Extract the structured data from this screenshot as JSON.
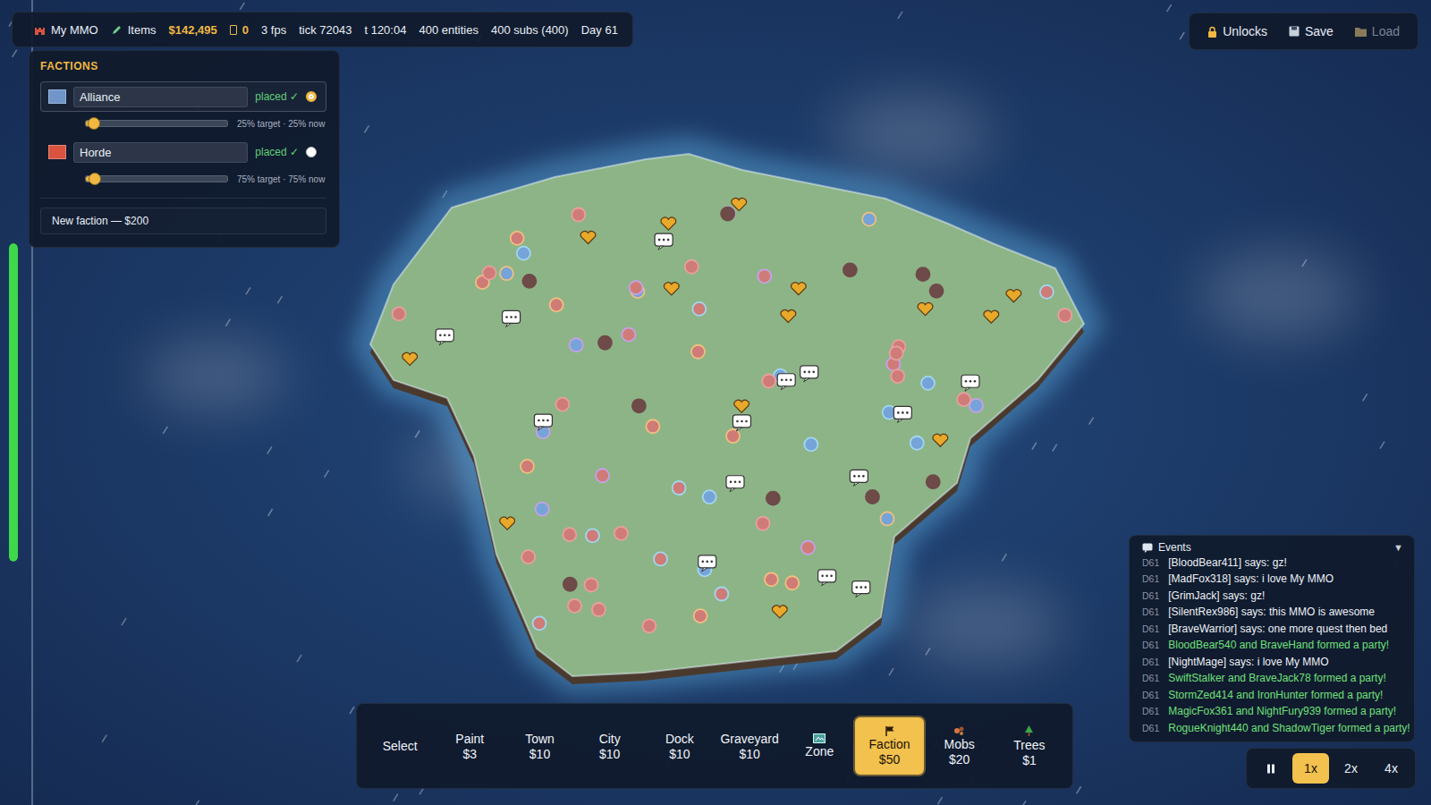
{
  "topbar": {
    "title": "My MMO",
    "items_button": "Items",
    "money": "$142,495",
    "gems": "0",
    "fps": "3 fps",
    "tick": "tick 72043",
    "time": "t 120:04",
    "entities": "400 entities",
    "subs": "400 subs (400)",
    "day": "Day 61"
  },
  "top_actions": [
    {
      "label": "Unlocks",
      "disabled": false
    },
    {
      "label": "Save",
      "disabled": false
    },
    {
      "label": "Load",
      "disabled": true
    }
  ],
  "factions": {
    "title": "FACTIONS",
    "items": [
      {
        "name": "Alliance",
        "color": "#6f95c9",
        "status": "placed ✓",
        "selected": true,
        "level": 0.03,
        "reading": "25% target · 25% now"
      },
      {
        "name": "Horde",
        "color": "#d9533f",
        "status": "placed ✓",
        "selected": false,
        "level": 0.04,
        "reading": "75% target · 75% now"
      }
    ],
    "new_button": "New faction — $200"
  },
  "side_meter": {
    "level": 1
  },
  "tools": [
    {
      "label": "Select",
      "price": "",
      "selected": false,
      "kind": "plain"
    },
    {
      "label": "Paint",
      "price": "$3",
      "selected": false,
      "kind": "plain"
    },
    {
      "label": "Town",
      "price": "$10",
      "selected": false,
      "kind": "plain"
    },
    {
      "label": "City",
      "price": "$10",
      "selected": false,
      "kind": "plain"
    },
    {
      "label": "Dock",
      "price": "$10",
      "selected": false,
      "kind": "plain"
    },
    {
      "label": "Graveyard",
      "price": "$10",
      "selected": false,
      "kind": "plain"
    },
    {
      "label": "Zone",
      "price": "",
      "selected": false,
      "kind": "icon"
    },
    {
      "label": "Faction",
      "price": "$50",
      "selected": true,
      "kind": "icon"
    },
    {
      "label": "Mobs",
      "price": "$20",
      "selected": false,
      "kind": "icon"
    },
    {
      "label": "Trees",
      "price": "$1",
      "selected": false,
      "kind": "icon"
    }
  ],
  "events": {
    "title": "Events",
    "toggle": "▼",
    "lines": [
      {
        "day": "D61",
        "text": "[BloodBear411] says: gz!",
        "kind": "chat"
      },
      {
        "day": "D61",
        "text": "[MadFox318] says: i love My MMO",
        "kind": "chat"
      },
      {
        "day": "D61",
        "text": "[GrimJack] says: gz!",
        "kind": "chat"
      },
      {
        "day": "D61",
        "text": "[SilentRex986] says: this MMO is awesome",
        "kind": "chat"
      },
      {
        "day": "D61",
        "text": "[BraveWarrior] says: one more quest then bed",
        "kind": "chat"
      },
      {
        "day": "D61",
        "text": "BloodBear540 and BraveHand formed a party!",
        "kind": "party"
      },
      {
        "day": "D61",
        "text": "[NightMage] says: i love My MMO",
        "kind": "chat"
      },
      {
        "day": "D61",
        "text": "SwiftStalker and BraveJack78 formed a party!",
        "kind": "party"
      },
      {
        "day": "D61",
        "text": "StormZed414 and IronHunter formed a party!",
        "kind": "party"
      },
      {
        "day": "D61",
        "text": "MagicFox361 and NightFury939 formed a party!",
        "kind": "party"
      },
      {
        "day": "D61",
        "text": "RogueKnight440 and ShadowTiger formed a party!",
        "kind": "party"
      }
    ]
  },
  "speed": {
    "paused": false,
    "options": [
      {
        "label": "1x",
        "selected": true
      },
      {
        "label": "2x",
        "selected": false
      },
      {
        "label": "4x",
        "selected": false
      }
    ]
  },
  "map": {
    "entities": [
      {
        "kind": "player",
        "color": "#cf7b78",
        "ring": "#e8a0a0"
      },
      {
        "kind": "player",
        "color": "#76a3d8",
        "ring": "#a0d8f0"
      },
      {
        "kind": "player",
        "color": "#cf7b78",
        "ring": "#f0c080"
      },
      {
        "kind": "player",
        "color": "#6e4a48",
        "ring": "#6e4a48"
      },
      {
        "kind": "player",
        "color": "#cf7b78",
        "ring": "#c8a0e8"
      },
      {
        "kind": "player",
        "color": "#cf7b78",
        "ring": "#e8a0a0"
      },
      {
        "kind": "player",
        "color": "#76a3d8",
        "ring": "#c8a0e8"
      },
      {
        "kind": "player",
        "color": "#cf7b78",
        "ring": "#a0d8f0"
      },
      {
        "kind": "player",
        "color": "#6e4a48",
        "ring": "#6e4a48"
      },
      {
        "kind": "player",
        "color": "#cf7b78",
        "ring": "#f0c080"
      },
      {
        "kind": "player",
        "color": "#cf7b78",
        "ring": "#e8a0a0"
      },
      {
        "kind": "player",
        "color": "#76a3d8",
        "ring": "#a0d8f0"
      },
      {
        "kind": "player",
        "color": "#cf7b78",
        "ring": "#c8a0e8"
      },
      {
        "kind": "player",
        "color": "#cf7b78",
        "ring": "#e8a0a0"
      },
      {
        "kind": "player",
        "color": "#6e4a48",
        "ring": "#6e4a48"
      },
      {
        "kind": "player",
        "color": "#cf7b78",
        "ring": "#f0c080"
      },
      {
        "kind": "player",
        "color": "#76a3d8",
        "ring": "#f0c080"
      },
      {
        "kind": "player",
        "color": "#cf7b78",
        "ring": "#e8a0a0"
      },
      {
        "kind": "player",
        "color": "#cf7b78",
        "ring": "#a0d8f0"
      },
      {
        "kind": "player",
        "color": "#76a3d8",
        "ring": "#a0d8f0"
      },
      {
        "kind": "player",
        "color": "#cf7b78",
        "ring": "#e8a0a0"
      },
      {
        "kind": "player",
        "color": "#6e4a48",
        "ring": "#6e4a48"
      },
      {
        "kind": "player",
        "color": "#cf7b78",
        "ring": "#c8a0e8"
      },
      {
        "kind": "player",
        "color": "#cf7b78",
        "ring": "#f0c080"
      },
      {
        "kind": "player",
        "color": "#76a3d8",
        "ring": "#c8a0e8"
      },
      {
        "kind": "player",
        "color": "#cf7b78",
        "ring": "#e8a0a0"
      },
      {
        "kind": "player",
        "color": "#cf7b78",
        "ring": "#e8a0a0"
      },
      {
        "kind": "player",
        "color": "#6e4a48",
        "ring": "#6e4a48"
      },
      {
        "kind": "player",
        "color": "#cf7b78",
        "ring": "#a0d8f0"
      },
      {
        "kind": "player",
        "color": "#76a3d8",
        "ring": "#a0d8f0"
      },
      {
        "kind": "player",
        "color": "#cf7b78",
        "ring": "#f0c080"
      },
      {
        "kind": "player",
        "color": "#cf7b78",
        "ring": "#e8a0a0"
      },
      {
        "kind": "player",
        "color": "#76a3d8",
        "ring": "#f0c080"
      },
      {
        "kind": "player",
        "color": "#cf7b78",
        "ring": "#c8a0e8"
      },
      {
        "kind": "player",
        "color": "#6e4a48",
        "ring": "#6e4a48"
      },
      {
        "kind": "player",
        "color": "#cf7b78",
        "ring": "#e8a0a0"
      },
      {
        "kind": "player",
        "color": "#cf7b78",
        "ring": "#a0d8f0"
      },
      {
        "kind": "player",
        "color": "#76a3d8",
        "ring": "#a0d8f0"
      },
      {
        "kind": "player",
        "color": "#cf7b78",
        "ring": "#e8a0a0"
      },
      {
        "kind": "player",
        "color": "#cf7b78",
        "ring": "#f0c080"
      },
      {
        "kind": "player",
        "color": "#6e4a48",
        "ring": "#6e4a48"
      },
      {
        "kind": "player",
        "color": "#cf7b78",
        "ring": "#c8a0e8"
      },
      {
        "kind": "player",
        "color": "#76a3d8",
        "ring": "#c8a0e8"
      },
      {
        "kind": "player",
        "color": "#cf7b78",
        "ring": "#e8a0a0"
      },
      {
        "kind": "player",
        "color": "#cf7b78",
        "ring": "#e8a0a0"
      },
      {
        "kind": "player",
        "color": "#76a3d8",
        "ring": "#a0d8f0"
      },
      {
        "kind": "player",
        "color": "#cf7b78",
        "ring": "#f0c080"
      },
      {
        "kind": "player",
        "color": "#6e4a48",
        "ring": "#6e4a48"
      },
      {
        "kind": "player",
        "color": "#cf7b78",
        "ring": "#a0d8f0"
      },
      {
        "kind": "player",
        "color": "#cf7b78",
        "ring": "#e8a0a0"
      },
      {
        "kind": "player",
        "color": "#76a3d8",
        "ring": "#f0c080"
      },
      {
        "kind": "player",
        "color": "#cf7b78",
        "ring": "#c8a0e8"
      },
      {
        "kind": "player",
        "color": "#cf7b78",
        "ring": "#e8a0a0"
      },
      {
        "kind": "player",
        "color": "#6e4a48",
        "ring": "#6e4a48"
      },
      {
        "kind": "player",
        "color": "#cf7b78",
        "ring": "#f0c080"
      },
      {
        "kind": "player",
        "color": "#76a3d8",
        "ring": "#a0d8f0"
      },
      {
        "kind": "player",
        "color": "#cf7b78",
        "ring": "#e8a0a0"
      },
      {
        "kind": "player",
        "color": "#cf7b78",
        "ring": "#a0d8f0"
      },
      {
        "kind": "player",
        "color": "#76a3d8",
        "ring": "#c8a0e8"
      },
      {
        "kind": "player",
        "color": "#cf7b78",
        "ring": "#e8a0a0"
      },
      {
        "kind": "player",
        "color": "#cf7b78",
        "ring": "#f0c080"
      },
      {
        "kind": "player",
        "color": "#6e4a48",
        "ring": "#6e4a48"
      },
      {
        "kind": "player",
        "color": "#cf7b78",
        "ring": "#c8a0e8"
      },
      {
        "kind": "player",
        "color": "#76a3d8",
        "ring": "#a0d8f0"
      },
      {
        "kind": "player",
        "color": "#cf7b78",
        "ring": "#e8a0a0"
      },
      {
        "kind": "player",
        "color": "#cf7b78",
        "ring": "#e8a0a0"
      },
      {
        "kind": "player",
        "color": "#76a3d8",
        "ring": "#f0c080"
      },
      {
        "kind": "player",
        "color": "#cf7b78",
        "ring": "#a0d8f0"
      },
      {
        "kind": "player",
        "color": "#6e4a48",
        "ring": "#6e4a48"
      },
      {
        "kind": "player",
        "color": "#cf7b78",
        "ring": "#f0c080"
      },
      {
        "kind": "chat",
        "color": "#ffffff",
        "ring": "#333333"
      },
      {
        "kind": "chat",
        "color": "#ffffff",
        "ring": "#333333"
      },
      {
        "kind": "chat",
        "color": "#ffffff",
        "ring": "#333333"
      },
      {
        "kind": "chat",
        "color": "#ffffff",
        "ring": "#333333"
      },
      {
        "kind": "chat",
        "color": "#ffffff",
        "ring": "#333333"
      },
      {
        "kind": "chat",
        "color": "#ffffff",
        "ring": "#333333"
      },
      {
        "kind": "chat",
        "color": "#ffffff",
        "ring": "#333333"
      },
      {
        "kind": "chat",
        "color": "#ffffff",
        "ring": "#333333"
      },
      {
        "kind": "chat",
        "color": "#ffffff",
        "ring": "#333333"
      },
      {
        "kind": "chat",
        "color": "#ffffff",
        "ring": "#333333"
      },
      {
        "kind": "chat",
        "color": "#ffffff",
        "ring": "#333333"
      },
      {
        "kind": "chat",
        "color": "#ffffff",
        "ring": "#333333"
      },
      {
        "kind": "chat",
        "color": "#ffffff",
        "ring": "#333333"
      },
      {
        "kind": "chat",
        "color": "#ffffff",
        "ring": "#333333"
      },
      {
        "kind": "heart",
        "color": "#e8a82a",
        "ring": "#5a3a10"
      },
      {
        "kind": "heart",
        "color": "#e8a82a",
        "ring": "#5a3a10"
      },
      {
        "kind": "heart",
        "color": "#e8a82a",
        "ring": "#5a3a10"
      },
      {
        "kind": "heart",
        "color": "#e8a82a",
        "ring": "#5a3a10"
      },
      {
        "kind": "heart",
        "color": "#e8a82a",
        "ring": "#5a3a10"
      },
      {
        "kind": "heart",
        "color": "#e8a82a",
        "ring": "#5a3a10"
      },
      {
        "kind": "heart",
        "color": "#e8a82a",
        "ring": "#5a3a10"
      },
      {
        "kind": "heart",
        "color": "#e8a82a",
        "ring": "#5a3a10"
      },
      {
        "kind": "heart",
        "color": "#e8a82a",
        "ring": "#5a3a10"
      },
      {
        "kind": "heart",
        "color": "#e8a82a",
        "ring": "#5a3a10"
      },
      {
        "kind": "heart",
        "color": "#e8a82a",
        "ring": "#5a3a10"
      },
      {
        "kind": "heart",
        "color": "#e8a82a",
        "ring": "#5a3a10"
      },
      {
        "kind": "heart",
        "color": "#e8a82a",
        "ring": "#5a3a10"
      },
      {
        "kind": "heart",
        "color": "#e8a82a",
        "ring": "#5a3a10"
      }
    ]
  }
}
